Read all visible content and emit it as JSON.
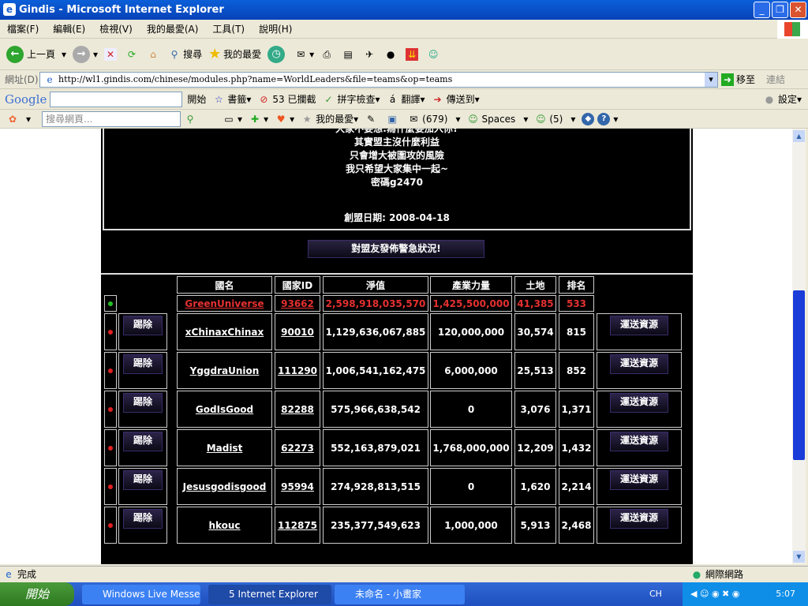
{
  "window": {
    "title": "Gindis - Microsoft Internet Explorer"
  },
  "menu": [
    "檔案(F)",
    "編輯(E)",
    "檢視(V)",
    "我的最愛(A)",
    "工具(T)",
    "說明(H)"
  ],
  "toolbar": {
    "back": "上一頁",
    "search": "搜尋",
    "favorites": "我的最愛"
  },
  "address": {
    "label": "網址(D)",
    "url": "http://wl1.gindis.com/chinese/modules.php?name=WorldLeaders&file=teams&op=teams",
    "go": "移至",
    "links": "連結"
  },
  "google_bar": {
    "logo": "Google",
    "go": "開始",
    "bookmarks": "書籤",
    "blocked": "53 已攔截",
    "spell": "拼字檢查",
    "translate": "翻譯",
    "send_to": "傳送到",
    "settings": "設定"
  },
  "msn_bar": {
    "search_placeholder": "搜尋網頁...",
    "favorites": "我的最愛",
    "mail": "(679)",
    "spaces": "Spaces",
    "contacts": "(5)"
  },
  "alliance": {
    "description_lines": [
      "大家不要想:為什麼要加入你?",
      "其實盟主沒什麼利益",
      "只會增大被圍攻的風險",
      "我只希望大家集中一起~",
      "密碼g2470"
    ],
    "founded": "創盟日期: 2008-04-18",
    "alert_button": "對盟友發佈警急狀況!"
  },
  "table": {
    "headers": [
      "國名",
      "國家ID",
      "淨值",
      "產業力量",
      "土地",
      "排名"
    ],
    "own": {
      "name": "GreenUniverse",
      "id": "93662",
      "networth": "2,598,918,035,570",
      "industry": "1,425,500,000",
      "land": "41,385",
      "rank": "533",
      "status_color": "#22c022"
    },
    "kick_label": "踢除",
    "send_label": "運送資源",
    "member_status_color": "#e02020",
    "members": [
      {
        "name": "xChinaxChinax",
        "id": "90010",
        "networth": "1,129,636,067,885",
        "industry": "120,000,000",
        "land": "30,574",
        "rank": "815"
      },
      {
        "name": "YggdraUnion",
        "id": "111290",
        "networth": "1,006,541,162,475",
        "industry": "6,000,000",
        "land": "25,513",
        "rank": "852"
      },
      {
        "name": "GodIsGood",
        "id": "82288",
        "networth": "575,966,638,542",
        "industry": "0",
        "land": "3,076",
        "rank": "1,371"
      },
      {
        "name": "Madist",
        "id": "62273",
        "networth": "552,163,879,021",
        "industry": "1,768,000,000",
        "land": "12,209",
        "rank": "1,432"
      },
      {
        "name": "Jesusgodisgood",
        "id": "95994",
        "networth": "274,928,813,515",
        "industry": "0",
        "land": "1,620",
        "rank": "2,214"
      },
      {
        "name": "hkouc",
        "id": "112875",
        "networth": "235,377,549,623",
        "industry": "1,000,000",
        "land": "5,913",
        "rank": "2,468"
      }
    ]
  },
  "status": {
    "text": "完成",
    "zone": "網際網路"
  },
  "taskbar": {
    "start": "開始",
    "tasks": [
      "Windows Live Messen...",
      "5 Internet Explorer",
      "未命名 - 小畫家"
    ],
    "lang": "CH",
    "clock": "5:07"
  }
}
